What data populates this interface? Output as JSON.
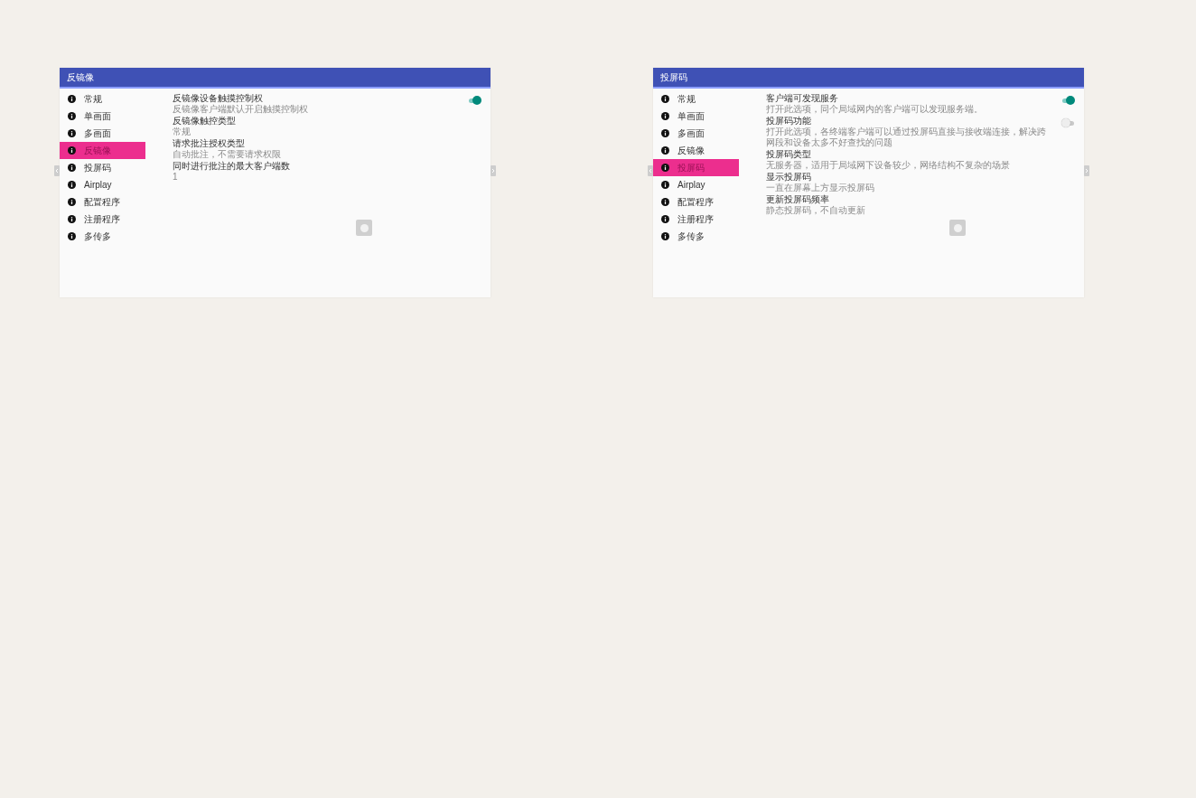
{
  "panels": [
    {
      "title": "反镜像",
      "sidebar": {
        "items": [
          {
            "label": "常规",
            "selected": false
          },
          {
            "label": "单画面",
            "selected": false
          },
          {
            "label": "多画面",
            "selected": false
          },
          {
            "label": "反镜像",
            "selected": true
          },
          {
            "label": "投屏码",
            "selected": false
          },
          {
            "label": "Airplay",
            "selected": false
          },
          {
            "label": "配置程序",
            "selected": false
          },
          {
            "label": "注册程序",
            "selected": false
          },
          {
            "label": "多传多",
            "selected": false
          }
        ]
      },
      "settings": [
        {
          "kind": "switch",
          "title": "反镜像设备触摸控制权",
          "subtitle": "反镜像客户端默认开启触摸控制权",
          "on": true
        },
        {
          "kind": "text",
          "title": "反镜像触控类型",
          "subtitle": "常规"
        },
        {
          "kind": "text",
          "title": "请求批注授权类型",
          "subtitle": "自动批注，不需要请求权限"
        },
        {
          "kind": "text",
          "title": "同时进行批注的最大客户端数",
          "subtitle": "1"
        }
      ]
    },
    {
      "title": "投屏码",
      "sidebar": {
        "items": [
          {
            "label": "常规",
            "selected": false
          },
          {
            "label": "单画面",
            "selected": false
          },
          {
            "label": "多画面",
            "selected": false
          },
          {
            "label": "反镜像",
            "selected": false
          },
          {
            "label": "投屏码",
            "selected": true
          },
          {
            "label": "Airplay",
            "selected": false
          },
          {
            "label": "配置程序",
            "selected": false
          },
          {
            "label": "注册程序",
            "selected": false
          },
          {
            "label": "多传多",
            "selected": false
          }
        ]
      },
      "settings": [
        {
          "kind": "switch",
          "title": "客户端可发现服务",
          "subtitle": "打开此选项，同个局域网内的客户端可以发现服务端。",
          "on": true
        },
        {
          "kind": "switch",
          "title": "投屏码功能",
          "subtitle": "打开此选项，各终端客户端可以通过投屏码直接与接收端连接，解决跨网段和设备太多不好查找的问题",
          "on": false
        },
        {
          "kind": "text",
          "title": "投屏码类型",
          "subtitle": "无服务器，适用于局域网下设备较少，网络结构不复杂的场景"
        },
        {
          "kind": "text",
          "title": "显示投屏码",
          "subtitle": "一直在屏幕上方显示投屏码"
        },
        {
          "kind": "text",
          "title": "更新投屏码频率",
          "subtitle": "静态投屏码，不自动更新"
        }
      ]
    }
  ]
}
